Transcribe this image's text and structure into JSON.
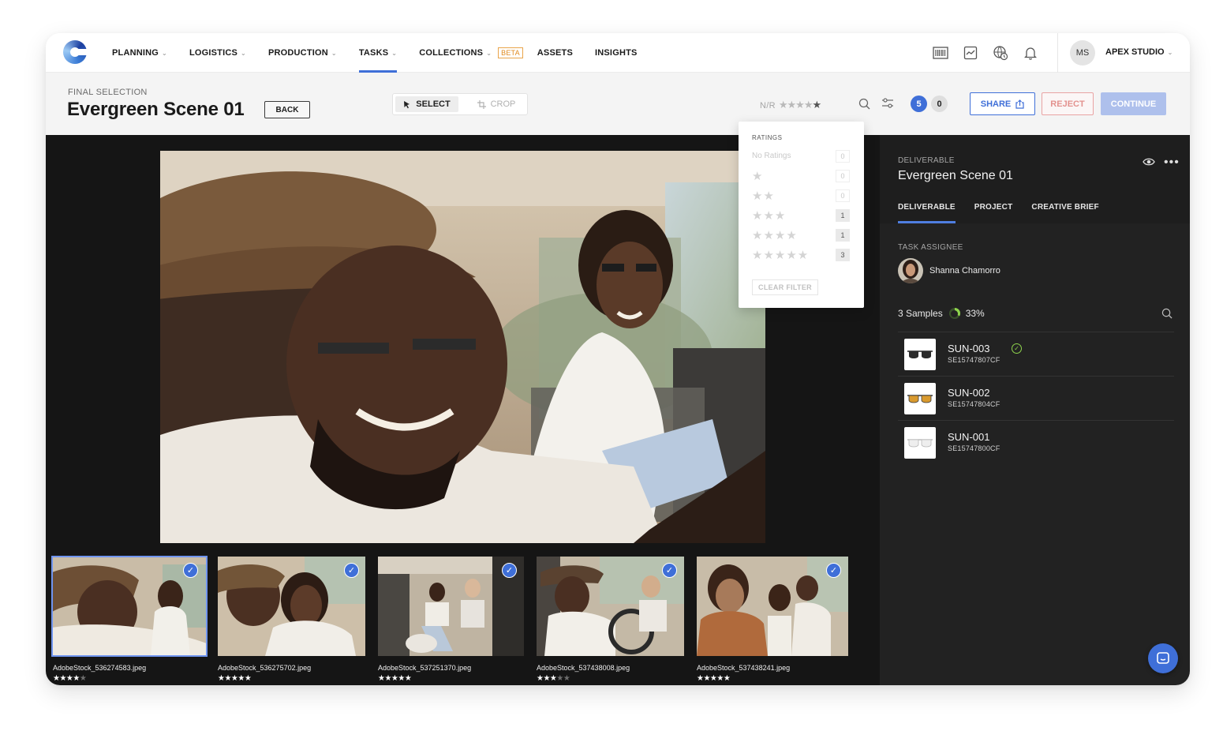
{
  "nav": {
    "items": [
      {
        "label": "PLANNING",
        "dropdown": true,
        "active": false
      },
      {
        "label": "LOGISTICS",
        "dropdown": true,
        "active": false
      },
      {
        "label": "PRODUCTION",
        "dropdown": true,
        "active": false
      },
      {
        "label": "TASKS",
        "dropdown": true,
        "active": true
      },
      {
        "label": "COLLECTIONS",
        "dropdown": true,
        "active": false,
        "badge": "BETA"
      },
      {
        "label": "ASSETS",
        "dropdown": false,
        "active": false
      },
      {
        "label": "INSIGHTS",
        "dropdown": false,
        "active": false
      }
    ],
    "icons": [
      "barcode-icon",
      "chart-icon",
      "globe-clock-icon",
      "bell-icon"
    ],
    "user_initials": "MS",
    "studio": "APEX STUDIO"
  },
  "header": {
    "eyebrow": "FINAL SELECTION",
    "title": "Evergreen Scene 01",
    "back_label": "BACK",
    "mode_select": "SELECT",
    "mode_crop": "CROP",
    "rating_filter_label": "N/R",
    "rating_filter_stars": 5,
    "selected_count": "5",
    "rejected_count": "0",
    "share_label": "SHARE",
    "reject_label": "REJECT",
    "continue_label": "CONTINUE"
  },
  "ratings": {
    "heading": "RATINGS",
    "no_ratings_label": "No Ratings",
    "rows": [
      {
        "stars": 0,
        "count": "0"
      },
      {
        "stars": 1,
        "count": "0"
      },
      {
        "stars": 2,
        "count": "0"
      },
      {
        "stars": 3,
        "count": "1"
      },
      {
        "stars": 4,
        "count": "1"
      },
      {
        "stars": 5,
        "count": "3"
      }
    ],
    "clear_label": "CLEAR FILTER"
  },
  "thumbnails": [
    {
      "file": "AdobeStock_536274583.jpeg",
      "rating": 4,
      "selected": true
    },
    {
      "file": "AdobeStock_536275702.jpeg",
      "rating": 5,
      "selected": true
    },
    {
      "file": "AdobeStock_537251370.jpeg",
      "rating": 5,
      "selected": true
    },
    {
      "file": "AdobeStock_537438008.jpeg",
      "rating": 3,
      "selected": true
    },
    {
      "file": "AdobeStock_537438241.jpeg",
      "rating": 5,
      "selected": true
    }
  ],
  "panel": {
    "eyebrow": "DELIVERABLE",
    "title": "Evergreen Scene 01",
    "tabs": [
      {
        "label": "DELIVERABLE",
        "active": true
      },
      {
        "label": "PROJECT",
        "active": false
      },
      {
        "label": "CREATIVE BRIEF",
        "active": false
      }
    ],
    "assignee_label": "TASK ASSIGNEE",
    "assignee_name": "Shanna Chamorro",
    "samples_label": "3 Samples",
    "samples_progress": "33%",
    "samples_fraction": 0.33,
    "samples": [
      {
        "name": "SUN-003",
        "sku": "SE15747807CF",
        "approved": true,
        "lens": "dark"
      },
      {
        "name": "SUN-002",
        "sku": "SE15747804CF",
        "approved": false,
        "lens": "amber"
      },
      {
        "name": "SUN-001",
        "sku": "SE15747800CF",
        "approved": false,
        "lens": "clear"
      }
    ]
  },
  "colors": {
    "accent": "#3f6fd8",
    "approve": "#8fd44d",
    "reject": "#e3928f",
    "beta": "#e08a1e"
  }
}
